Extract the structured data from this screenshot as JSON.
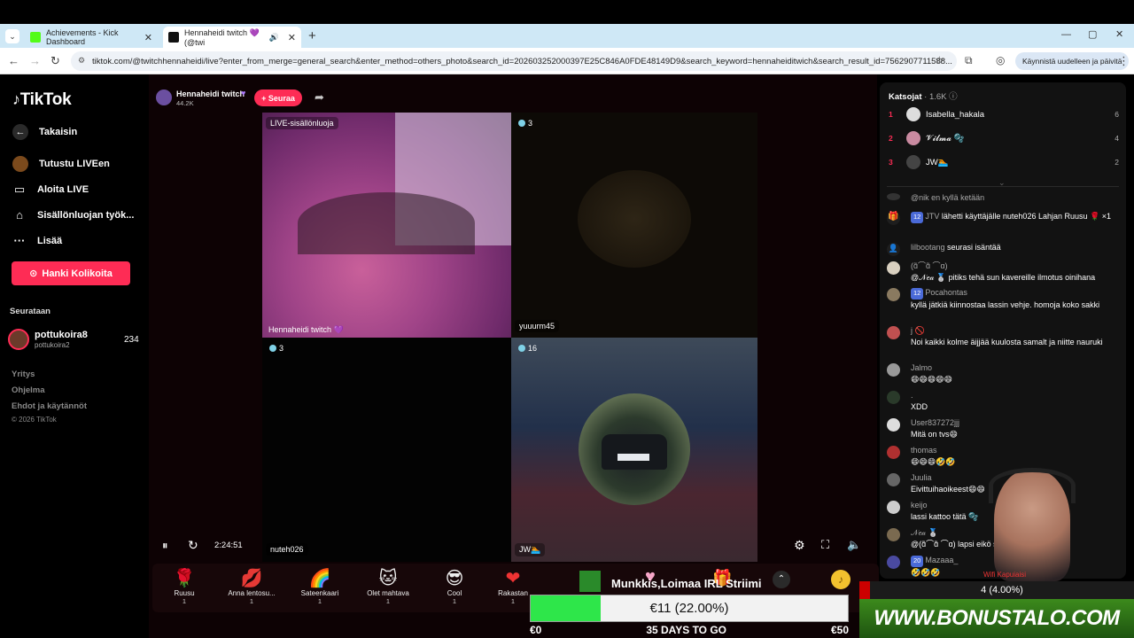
{
  "browser": {
    "tabs": [
      {
        "title": "Achievements - Kick Dashboard",
        "favicon_color": "#53fc18"
      },
      {
        "title": "Hennaheidi twitch 💜 (@twi",
        "favicon_color": "#111111"
      }
    ],
    "url": "tiktok.com/@twitchhennaheidi/live?enter_from_merge=general_search&enter_method=others_photo&search_id=202603252000397E25C846A0FDE48149D9&search_keyword=hennaheiditwich&search_result_id=7562907711588...",
    "restart_label": "Käynnistä uudelleen ja päivitä",
    "window_controls": [
      "—",
      "▢",
      "✕"
    ]
  },
  "sidebar": {
    "logo": "TikTok",
    "back": "Takaisin",
    "nav": [
      {
        "label": "Tutustu LIVEen",
        "icon": "live-explore-icon"
      },
      {
        "label": "Aloita LIVE",
        "icon": "camera-icon"
      },
      {
        "label": "Sisällönluojan työk...",
        "icon": "creator-tools-icon"
      },
      {
        "label": "Lisää",
        "icon": "more-icon"
      }
    ],
    "coins_button": "Hanki Kolikoita",
    "following_title": "Seurataan",
    "following": [
      {
        "name": "pottukoira8",
        "handle": "pottukoira2",
        "count": "234"
      }
    ],
    "footer": [
      "Yritys",
      "Ohjelma",
      "Ehdot ja käytännöt",
      "© 2026 TikTok"
    ]
  },
  "stream": {
    "host_name": "Hennaheidi twitch",
    "host_likes": "44.2K",
    "follow_label": "+ Seuraa",
    "tiles": [
      {
        "top_label": "LIVE-sisällönluoja",
        "bottom_label": "Hennaheidi twitch 💜"
      },
      {
        "viewers": "3",
        "bottom_label": "yuuurm45"
      },
      {
        "viewers": "3",
        "bottom_label": "nuteh026"
      },
      {
        "viewers": "16",
        "bottom_label": "JW🏊"
      }
    ],
    "time": "2:24:51"
  },
  "gifts": [
    {
      "name": "Ruusu",
      "cost": "1",
      "glyph": "🌹"
    },
    {
      "name": "Anna lentosu...",
      "cost": "1",
      "glyph": "💋"
    },
    {
      "name": "Sateenkaari",
      "cost": "1",
      "glyph": "🌈"
    },
    {
      "name": "Olet mahtava",
      "cost": "1",
      "glyph": "🐱"
    },
    {
      "name": "Cool",
      "cost": "1",
      "glyph": "😎"
    },
    {
      "name": "Rakastan",
      "cost": "1",
      "glyph": "❤"
    }
  ],
  "viewers_panel": {
    "title": "Katsojat",
    "count": "1.6K",
    "top": [
      {
        "rank": "1",
        "name": "Isabella_hakala",
        "score": "6"
      },
      {
        "rank": "2",
        "name": "𝓥𝓲𝓵𝓶𝓪 🫧",
        "score": "4"
      },
      {
        "rank": "3",
        "name": "JW🏊",
        "score": "2"
      }
    ]
  },
  "chat": [
    {
      "user": "",
      "msg": "@nik en kyllä ketään"
    },
    {
      "user": "JTV",
      "level": "12",
      "msg": "lähetti käyttäjälle nuteh026 Lahjan Ruusu 🌹 ×1"
    },
    {
      "user": "lilbootang",
      "msg": "seurasi isäntää"
    },
    {
      "user": "(ɑ̃⌒ɑ̃ ⌒ɑ)",
      "msg": "@𝒩𝑒𝒶 🥈 pitiks tehä sun kavereille ilmotus oinihana"
    },
    {
      "user": "Pocahontas",
      "level": "12",
      "msg": "kyllä jätkiä kiinnostaa lassin vehje. homoja koko sakki"
    },
    {
      "user": "j 🚫",
      "msg": "Noi kaikki kolme äijjää kuulosta samalt ja niitte nauruki"
    },
    {
      "user": "Jalmo",
      "msg": "😄😄😄😄😄"
    },
    {
      "user": ".",
      "msg": "XDD"
    },
    {
      "user": "User837272jjj",
      "msg": "Mitä on tvs😄"
    },
    {
      "user": "thomas",
      "msg": "😄😄😄🤣🤣"
    },
    {
      "user": "Juulia",
      "msg": "Eivittuihaoikeest😄😄"
    },
    {
      "user": "keijo",
      "msg": "lassi kattoo tätä 🫧"
    },
    {
      "user": "𝒩𝑒𝒶 🥈",
      "msg": "@(ɑ̃⌒ɑ̃ ⌒ɑ) lapsi eikö sulla"
    },
    {
      "user": "Mazaaa_",
      "level": "20",
      "msg": "🤣🤣🤣"
    }
  ],
  "overlay": {
    "goal_title": "Munkkis,Loimaa IRL Striimi",
    "goal_value": "€11 (22.00%)",
    "goal_progress": 0.22,
    "goal_min": "€0",
    "goal_max": "€50",
    "days_left": "35 DAYS TO GO",
    "sub_percent": "4 (4.00%)",
    "sponsor": "WWW.BONUSTALO.COM",
    "wifi_label": "Wifi Kapuiaisi"
  },
  "colors": {
    "accent": "#fe2c55",
    "goal_fill": "#2ee64a"
  }
}
